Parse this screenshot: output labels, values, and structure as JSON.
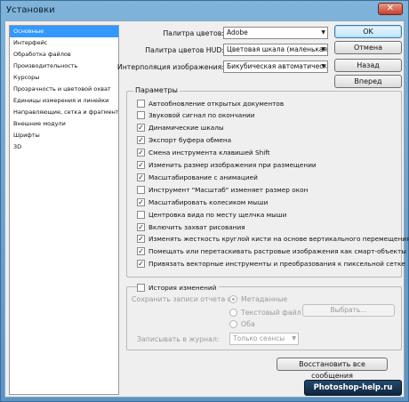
{
  "window": {
    "title": "Установки",
    "close_glyph": "✕"
  },
  "nav": {
    "items": [
      "Основные",
      "Интерфейс",
      "Обработка файлов",
      "Производительность",
      "Курсоры",
      "Прозрачность и цветовой охват",
      "Единицы измерения и линейки",
      "Направляющие, сетка и фрагменты",
      "Внешние модули",
      "Шрифты",
      "3D"
    ],
    "selected_index": 0
  },
  "form": {
    "color_picker_label": "Палитра цветов:",
    "color_picker_value": "Adobe",
    "hud_picker_label": "Палитра цветов HUD:",
    "hud_picker_value": "Цветовая шкала (маленькая)",
    "interpolation_label": "Интерполяция изображения:",
    "interpolation_value": "Бикубическая автоматическая"
  },
  "buttons": {
    "ok": "OK",
    "cancel": "Отмена",
    "back": "Назад",
    "forward": "Вперед",
    "reset_warnings": "Восстановить все сообщения"
  },
  "options": {
    "title": "Параметры",
    "items": [
      {
        "label": "Автообновление открытых документов",
        "checked": false
      },
      {
        "label": "Звуковой сигнал по окончании",
        "checked": false
      },
      {
        "label": "Динамические шкалы",
        "checked": true
      },
      {
        "label": "Экспорт буфера обмена",
        "checked": true
      },
      {
        "label": "Смена инструмента клавишей Shift",
        "checked": true
      },
      {
        "label": "Изменить размер изображения при размещении",
        "checked": true
      },
      {
        "label": "Масштабирование с анимацией",
        "checked": true
      },
      {
        "label": "Инструмент \"Масштаб\" изменяет размер окон",
        "checked": false
      },
      {
        "label": "Масштабировать колесиком мыши",
        "checked": true
      },
      {
        "label": "Центровка вида по месту щелчка мыши",
        "checked": false
      },
      {
        "label": "Включить захват рисования",
        "checked": true
      },
      {
        "label": "Изменять жесткость круглой кисти на основе вертикального перемещения H",
        "checked": true
      },
      {
        "label": "Помещать или перетаскивать растровые изображения как смарт-объекты",
        "checked": true
      },
      {
        "label": "Привязать векторные инструменты и преобразования к пиксельной сетке",
        "checked": true
      }
    ]
  },
  "history": {
    "checkbox_label": "История изменений",
    "checked": false,
    "save_label": "Сохранить записи отчета в:",
    "radio_metadata": "Метаданные",
    "radio_textfile": "Текстовый файл",
    "radio_both": "Оба",
    "browse_label": "Выбрать...",
    "log_label": "Записывать в журнал:",
    "log_value": "Только сеансы"
  },
  "watermark": "Photoshop-help.ru",
  "colors": {
    "title_bar": "#6fa6d3",
    "selection": "#3399ff",
    "dialog_bg": "#efefef"
  }
}
